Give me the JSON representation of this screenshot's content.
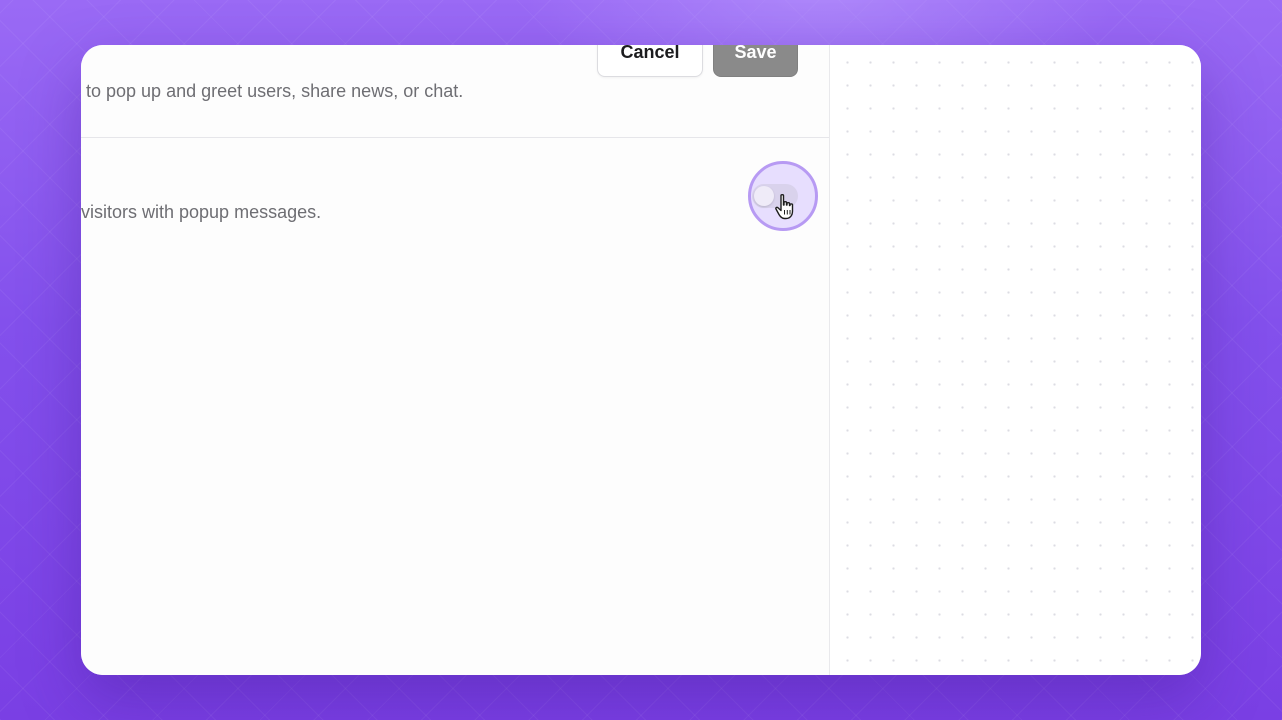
{
  "header": {
    "description": "to pop up and greet users, share news, or chat.",
    "cancel_label": "Cancel",
    "save_label": "Save"
  },
  "setting": {
    "description": "visitors with popup messages.",
    "toggle_state": "off"
  },
  "icons": {
    "cursor": "hand-pointer-icon"
  },
  "colors": {
    "background_accent": "#8350ec",
    "save_button": "#8a8a8a",
    "highlight_ring": "#b79af3"
  }
}
